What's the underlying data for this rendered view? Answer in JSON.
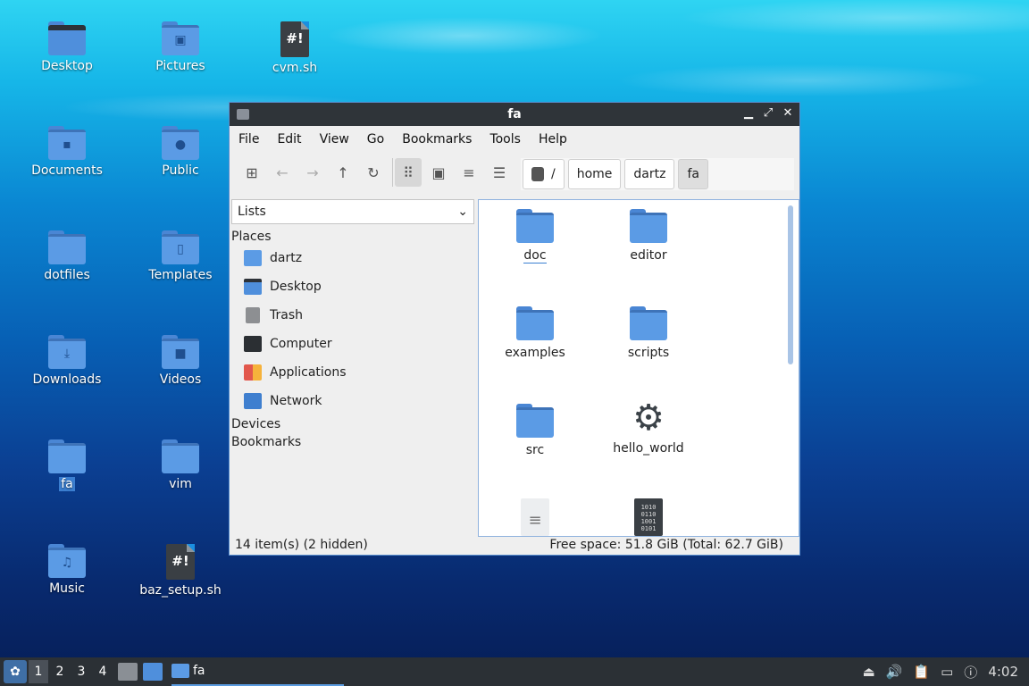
{
  "desktop": {
    "icons": [
      {
        "label": "Desktop",
        "icon": "desktop-folder-icon"
      },
      {
        "label": "Pictures",
        "icon": "pictures-folder-icon"
      },
      {
        "label": "cvm.sh",
        "icon": "shell-script-icon",
        "glyph": "#!"
      },
      {
        "label": "Documents",
        "icon": "documents-folder-icon"
      },
      {
        "label": "Public",
        "icon": "public-folder-icon"
      },
      {
        "label": "dotfiles",
        "icon": "folder-icon"
      },
      {
        "label": "Templates",
        "icon": "templates-folder-icon"
      },
      {
        "label": "Downloads",
        "icon": "downloads-folder-icon"
      },
      {
        "label": "Videos",
        "icon": "videos-folder-icon"
      },
      {
        "label": "fa",
        "icon": "folder-icon"
      },
      {
        "label": "vim",
        "icon": "folder-icon"
      },
      {
        "label": "Music",
        "icon": "music-folder-icon"
      },
      {
        "label": "baz_setup.sh",
        "icon": "shell-script-icon",
        "glyph": "#!"
      }
    ]
  },
  "window": {
    "title": "fa",
    "menu": [
      "File",
      "Edit",
      "View",
      "Go",
      "Bookmarks",
      "Tools",
      "Help"
    ],
    "breadcrumb": [
      "/",
      "home",
      "dartz",
      "fa"
    ],
    "sidebar": {
      "mode": "Lists",
      "places_header": "Places",
      "places": [
        "dartz",
        "Desktop",
        "Trash",
        "Computer",
        "Applications",
        "Network"
      ],
      "devices_header": "Devices",
      "bookmarks_header": "Bookmarks"
    },
    "files": [
      "doc",
      "editor",
      "examples",
      "scripts",
      "src",
      "hello_world"
    ],
    "status_left": "14 item(s) (2 hidden)",
    "status_right": "Free space: 51.8 GiB (Total: 62.7 GiB)"
  },
  "taskbar": {
    "workspaces": [
      "1",
      "2",
      "3",
      "4"
    ],
    "task_label": "fa",
    "clock": "4:02"
  },
  "colors": {
    "accent": "#3b7fd1",
    "folder": "#5b9be5",
    "titlebar": "#2f3439"
  }
}
